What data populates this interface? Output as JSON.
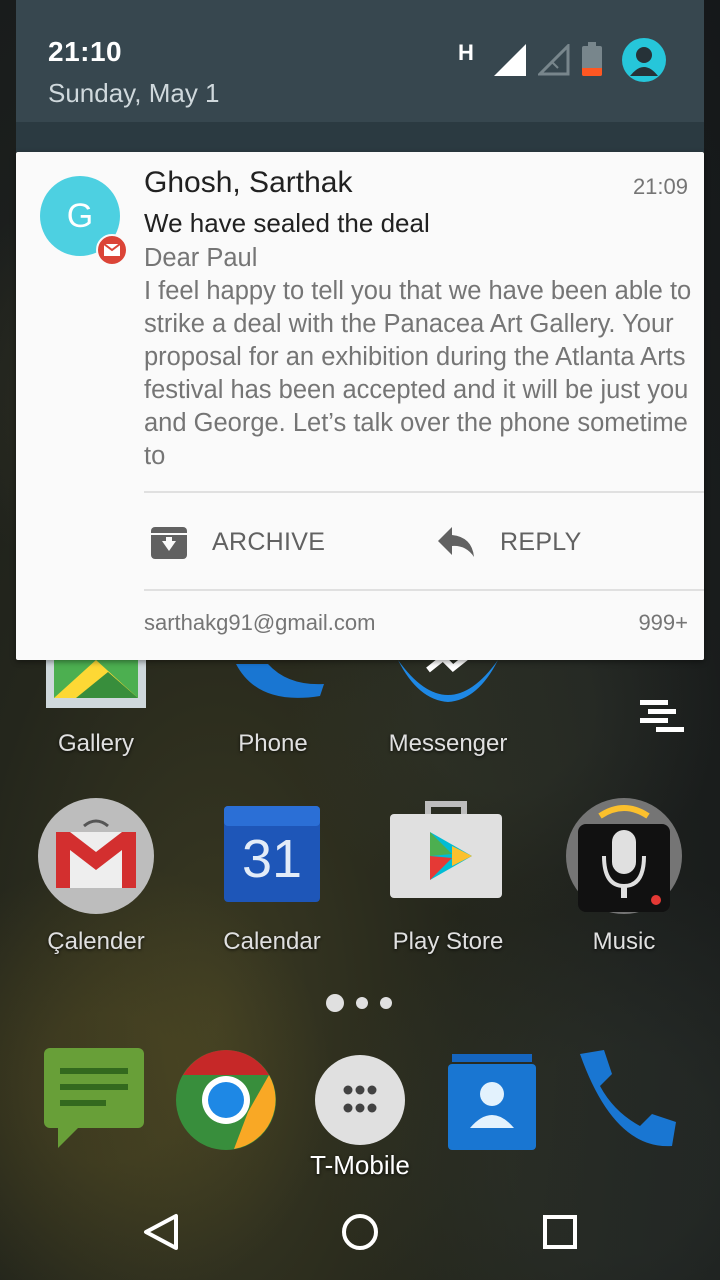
{
  "status": {
    "time": "21:10",
    "date": "Sunday, May 1",
    "network_type": "H",
    "battery_level": 0.25
  },
  "notification": {
    "sender_initial": "G",
    "sender": "Ghosh, Sarthak",
    "time": "21:09",
    "subject": "We have sealed the deal",
    "body": "Dear Paul\nI feel happy to tell you that we have been able to strike a deal with the Panacea Art Gallery. Your proposal for an exhibition during the Atlanta Arts festival has been accepted and it will be just you and George. Let’s talk over the phone sometime to",
    "actions": [
      {
        "label": "ARCHIVE",
        "icon": "archive-icon"
      },
      {
        "label": "REPLY",
        "icon": "reply-icon"
      }
    ],
    "account": "sarthakg91@gmail.com",
    "count": "999+"
  },
  "home": {
    "row1": [
      {
        "label": "Gallery",
        "icon": "gallery-icon"
      },
      {
        "label": "Phone",
        "icon": "phone-icon"
      },
      {
        "label": "Messenger",
        "icon": "messenger-icon"
      }
    ],
    "row2": [
      {
        "label": "Çalender",
        "icon": "gmail-icon"
      },
      {
        "label": "Calendar",
        "icon": "calendar-icon",
        "badge": "31"
      },
      {
        "label": "Play Store",
        "icon": "play-store-icon"
      },
      {
        "label": "Music",
        "icon": "microphone-icon"
      }
    ],
    "dock": [
      "messages-icon",
      "chrome-icon",
      "app-drawer-icon",
      "contacts-icon",
      "phone-icon"
    ],
    "carrier": "T-Mobile"
  },
  "colors": {
    "shade": "#37474f",
    "avatar": "#4dd0e1",
    "gmail_red": "#db4437",
    "accent": "#26c6da"
  }
}
